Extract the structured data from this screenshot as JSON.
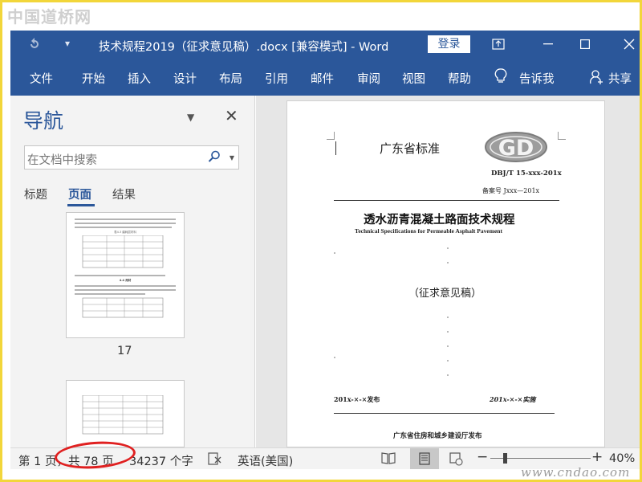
{
  "watermark": {
    "top": "中国道桥网",
    "bottom": "www.cndao.com"
  },
  "window": {
    "title": "技术规程2019（征求意见稿）.docx [兼容模式]  -  Word",
    "login": "登录"
  },
  "ribbon": {
    "tabs": [
      "文件",
      "开始",
      "插入",
      "设计",
      "布局",
      "引用",
      "邮件",
      "审阅",
      "视图",
      "帮助",
      "告诉我",
      "共享"
    ]
  },
  "nav": {
    "title": "导航",
    "search_placeholder": "在文档中搜索",
    "tabs": [
      "标题",
      "页面",
      "结果"
    ],
    "active_tab": "页面",
    "thumb_page_number": "17",
    "thumb_page_table_title": "表4.3 磨耗层材料",
    "thumb_page_section": "4.4  用材"
  },
  "document": {
    "header_label": "广东省标准",
    "logo": "GD",
    "code": "DBJ/T 15-xxx-201x",
    "record": "备案号  Jxxx—201x",
    "title_cn": "透水沥青混凝土路面技术规程",
    "title_en": "Technical Specifications for Permeable Asphalt Pavement",
    "draft": "（征求意见稿）",
    "publish_date": "201x-×-×发布",
    "effective_date": "201x-×-×实施",
    "publisher": "广东省住房和城乡建设厅发布"
  },
  "status": {
    "page": "第 1 页，共 78 页",
    "words": "34237 个字",
    "language": "英语(美国)",
    "zoom": "40%"
  },
  "colors": {
    "accent": "#2b579a",
    "highlight_circle": "#e02020",
    "frame": "#f2d63a"
  }
}
